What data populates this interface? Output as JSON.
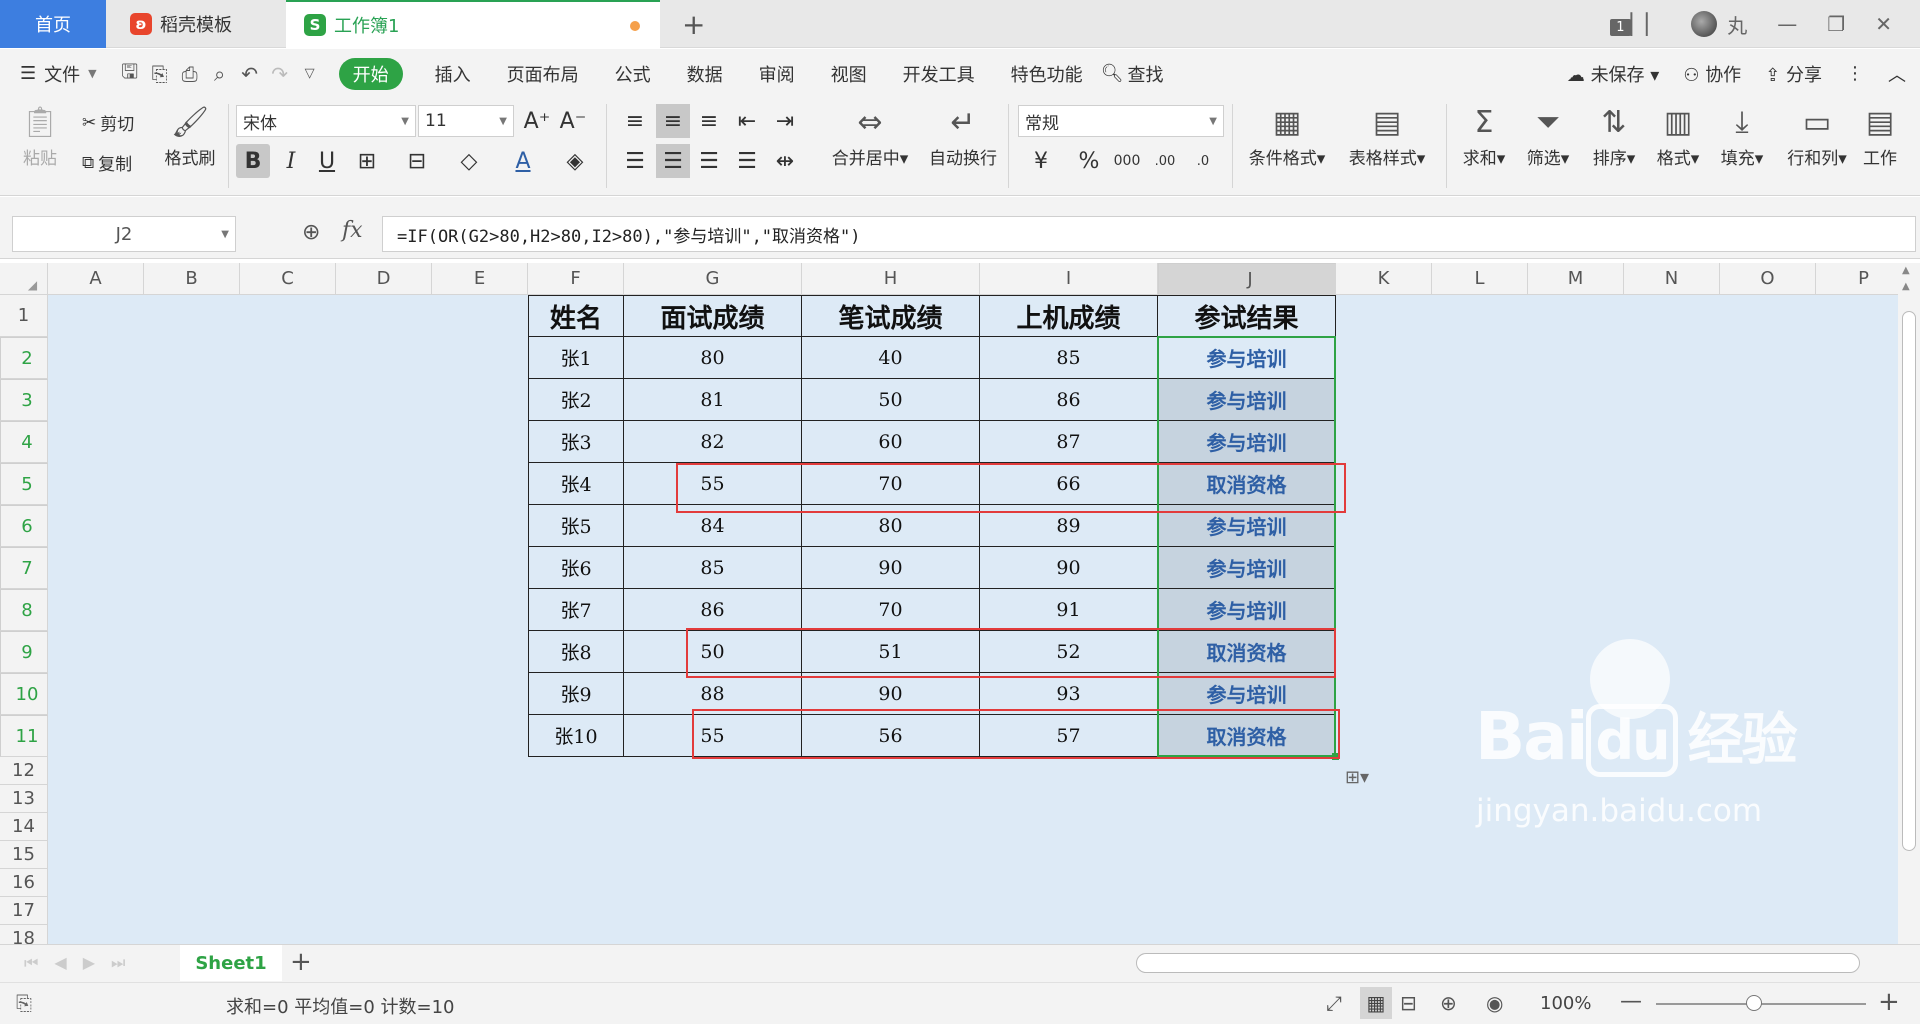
{
  "tabs": {
    "home": "首页",
    "template": "稻壳模板",
    "workbook": "工作簿1",
    "workbook_icon": "S"
  },
  "window": {
    "badge": "1",
    "user": "丸"
  },
  "menu": {
    "file": "文件",
    "items": [
      "开始",
      "插入",
      "页面布局",
      "公式",
      "数据",
      "审阅",
      "视图",
      "开发工具",
      "特色功能"
    ],
    "search": "查找",
    "unsaved": "未保存",
    "collab": "协作",
    "share": "分享"
  },
  "ribbon": {
    "paste": "粘贴",
    "cut": "剪切",
    "copy": "复制",
    "format_painter": "格式刷",
    "font": "宋体",
    "font_size": "11",
    "merge_center": "合并居中",
    "wrap": "自动换行",
    "number_format": "常规",
    "cond_format": "条件格式",
    "table_style": "表格样式",
    "sum": "求和",
    "filter": "筛选",
    "sort": "排序",
    "format": "格式",
    "fill": "填充",
    "row_col": "行和列",
    "worksheet": "工作"
  },
  "formula_bar": {
    "name_box": "J2",
    "fx": "fx",
    "formula": "=IF(OR(G2>80,H2>80,I2>80),\"参与培训\",\"取消资格\")"
  },
  "columns": [
    "A",
    "B",
    "C",
    "D",
    "E",
    "F",
    "G",
    "H",
    "I",
    "J",
    "K",
    "L",
    "M",
    "N",
    "O",
    "P"
  ],
  "rows": [
    "1",
    "2",
    "3",
    "4",
    "5",
    "6",
    "7",
    "8",
    "9",
    "10",
    "11",
    "12",
    "13",
    "14",
    "15",
    "16",
    "17",
    "18"
  ],
  "table": {
    "headers": [
      "姓名",
      "面试成绩",
      "笔试成绩",
      "上机成绩",
      "参试结果"
    ],
    "rows": [
      [
        "张1",
        "80",
        "40",
        "85",
        "参与培训"
      ],
      [
        "张2",
        "81",
        "50",
        "86",
        "参与培训"
      ],
      [
        "张3",
        "82",
        "60",
        "87",
        "参与培训"
      ],
      [
        "张4",
        "55",
        "70",
        "66",
        "取消资格"
      ],
      [
        "张5",
        "84",
        "80",
        "89",
        "参与培训"
      ],
      [
        "张6",
        "85",
        "90",
        "90",
        "参与培训"
      ],
      [
        "张7",
        "86",
        "70",
        "91",
        "参与培训"
      ],
      [
        "张8",
        "50",
        "51",
        "52",
        "取消资格"
      ],
      [
        "张9",
        "88",
        "90",
        "93",
        "参与培训"
      ],
      [
        "张10",
        "55",
        "56",
        "57",
        "取消资格"
      ]
    ]
  },
  "sheet_tabs": {
    "sheet1": "Sheet1"
  },
  "status": {
    "summary": "求和=0  平均值=0  计数=10",
    "zoom": "100%"
  },
  "watermark": {
    "brand": "Bai",
    "brand2": "du",
    "cn": "经验",
    "url": "jingyan.baidu.com"
  },
  "colors": {
    "accent_green": "#2ea345",
    "tab_blue": "#3d7ee0",
    "highlight_red": "#e23b3b",
    "result_blue": "#2e5fa5"
  }
}
